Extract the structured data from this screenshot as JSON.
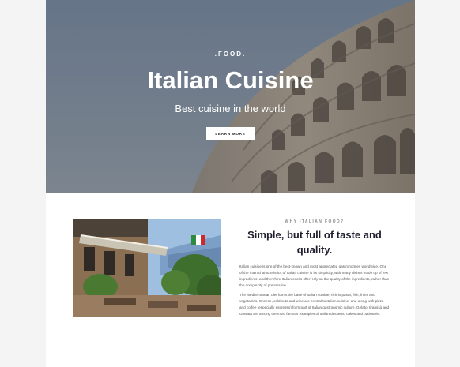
{
  "hero": {
    "tag": ".FOOD.",
    "title": "Italian Cuisine",
    "subtitle": "Best cuisine in the world",
    "button_label": "LEARN MORE"
  },
  "about": {
    "eyebrow": "WHY ITALIAN FOOD?",
    "title": "Simple, but full of taste and quality.",
    "paragraphs": [
      "Italian cuisine is one of the best-known and most appreciated gastronomies worldwide. One of the main characteristics of Italian cuisine is its simplicity, with many dishes made up of few ingredients, and therefore Italian cooks often rely on the quality of the ingredients, rather than the complexity of preparation.",
      "The Mediterranean diet forms the base of Italian cuisine, rich in pasta, fish, fruits and vegetables. Cheese, cold cuts and wine are central to Italian cuisine, and along with pizza and coffee (especially espresso) form part of Italian gastronomic culture. Gelato, tiramisù and cassata are among the most famous examples of Italian desserts, cakes and patisserie."
    ]
  },
  "colors": {
    "page_background": "#f4f4f4",
    "container_background": "#ffffff",
    "hero_text": "#ffffff",
    "heading_text": "#1e1e2e",
    "body_text": "#555555"
  }
}
